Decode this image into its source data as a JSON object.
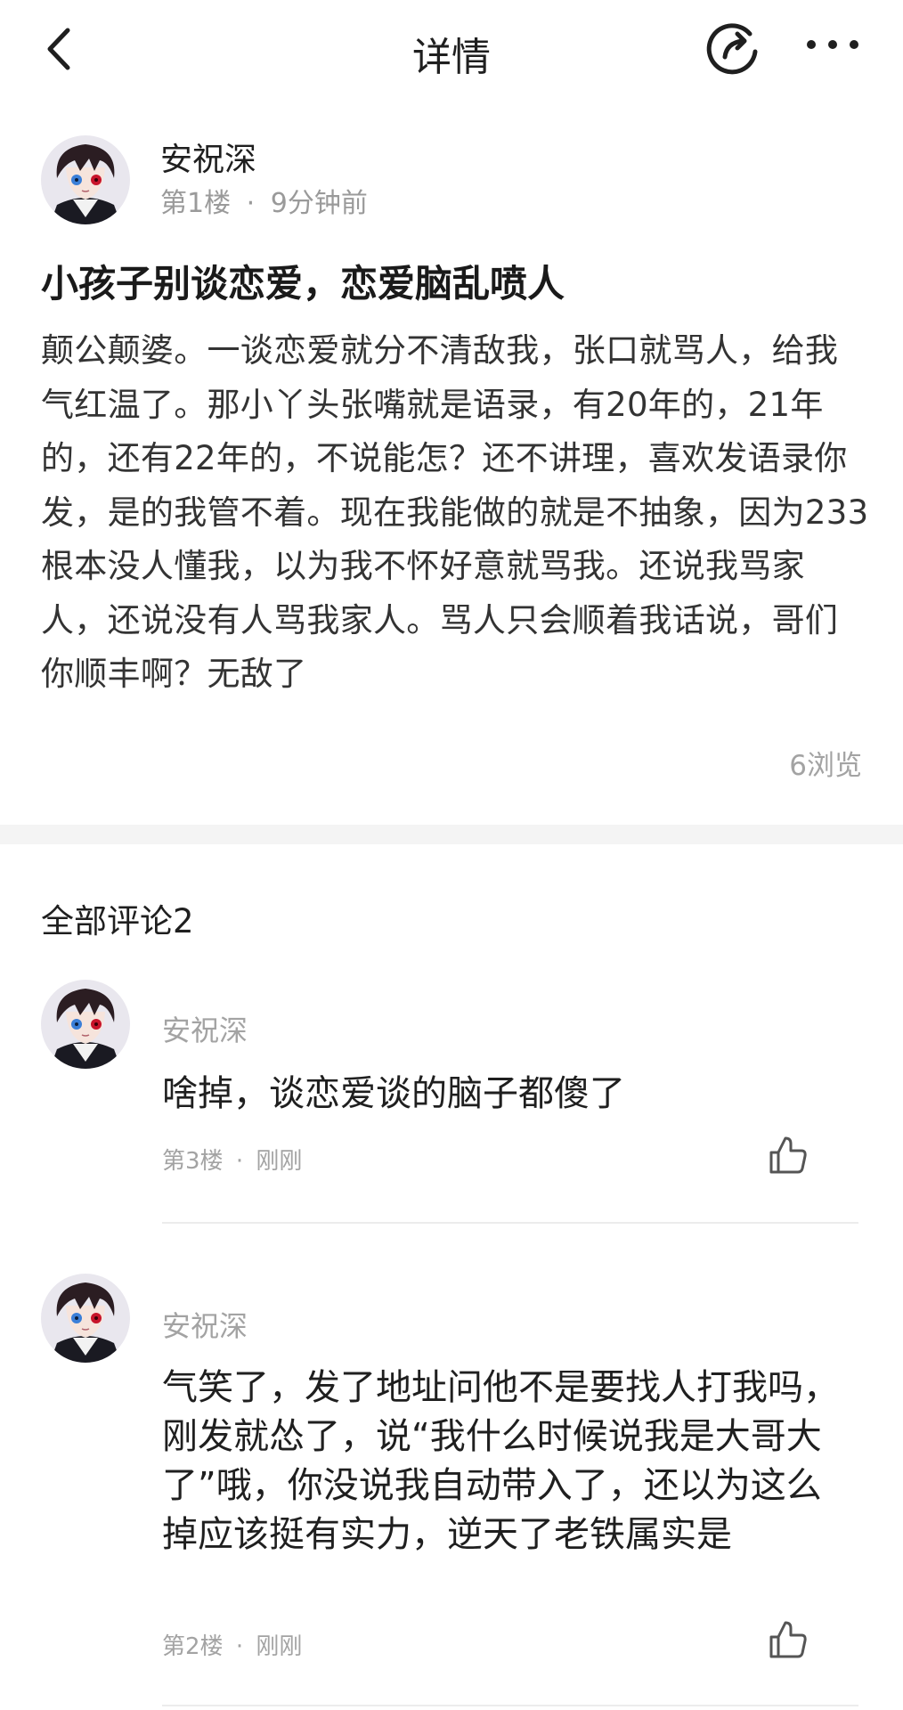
{
  "header": {
    "title": "详情"
  },
  "icons": {
    "back": "chevron-left-icon",
    "share": "share-icon",
    "more": "more-icon",
    "like": "thumbs-up-icon"
  },
  "post": {
    "author": "安祝深",
    "floor": "第1楼",
    "separator": "·",
    "time": "9分钟前",
    "title": "小孩子别谈恋爱，恋爱脑乱喷人",
    "body": "颠公颠婆。一谈恋爱就分不清敌我，张口就骂人，给我气红温了。那小丫头张嘴就是语录，有20年的，21年的，还有22年的，不说能怎？还不讲理，喜欢发语录你发，是的我管不着。现在我能做的就是不抽象，因为233根本没人懂我，以为我不怀好意就骂我。还说我骂家人，还说没有人骂我家人。骂人只会顺着我话说，哥们你顺丰啊？无敌了",
    "views": "6浏览"
  },
  "comments_section": {
    "heading": "全部评论2"
  },
  "comments": [
    {
      "author": "安祝深",
      "text": "啥掉，谈恋爱谈的脑子都傻了",
      "floor": "第3楼",
      "separator": "·",
      "time": "刚刚"
    },
    {
      "author": "安祝深",
      "text": "气笑了，发了地址问他不是要找人打我吗，刚发就怂了，说“我什么时候说我是大哥大了”哦，你没说我自动带入了，还以为这么掉应该挺有实力，逆天了老铁属实是",
      "floor": "第2楼",
      "separator": "·",
      "time": "刚刚"
    }
  ],
  "colors": {
    "text_primary": "#1f1f1f",
    "text_secondary": "#9a9a9a",
    "divider": "#f4f4f4"
  }
}
